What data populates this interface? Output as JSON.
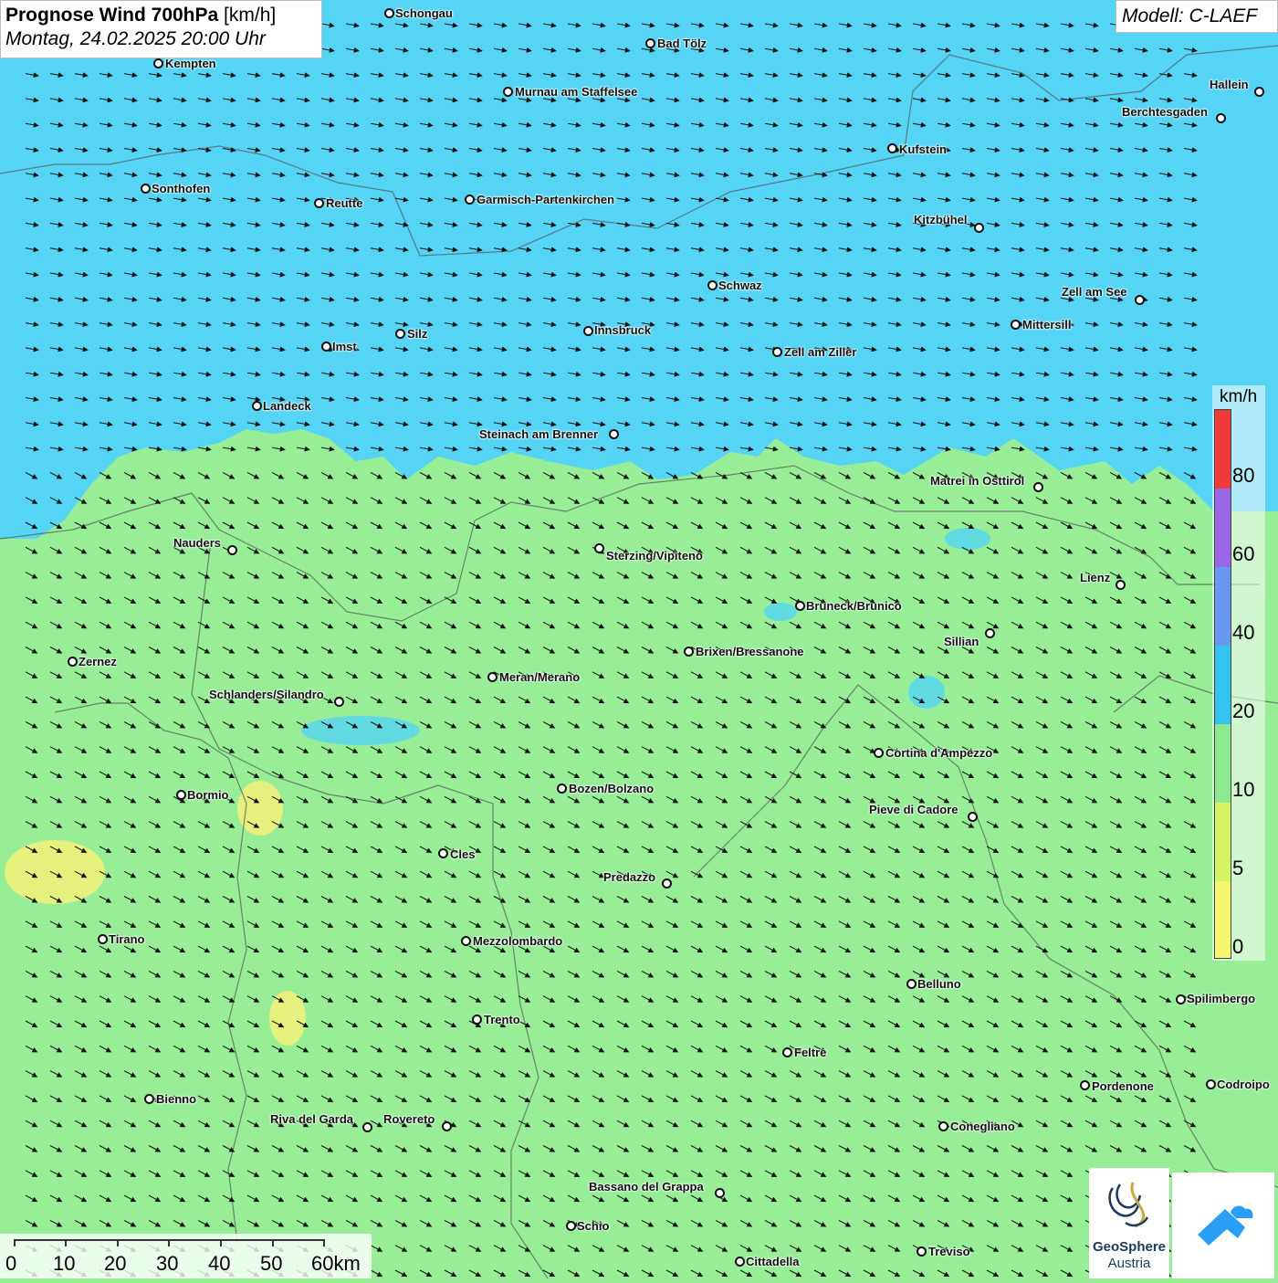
{
  "header": {
    "title_main": "Prognose Wind 700hPa",
    "title_unit": "[km/h]",
    "subtitle": "Montag, 24.02.2025 20:00 Uhr"
  },
  "model": {
    "label": "Modell: C-LAEF"
  },
  "legend": {
    "unit": "km/h",
    "levels": [
      {
        "label": "0",
        "color": "#f5f56e"
      },
      {
        "label": "5",
        "color": "#d6f566"
      },
      {
        "label": "10",
        "color": "#8ee88e"
      },
      {
        "label": "20",
        "color": "#33c3ef"
      },
      {
        "label": "40",
        "color": "#6699ee"
      },
      {
        "label": "60",
        "color": "#9966e6"
      },
      {
        "label": "80",
        "color": "#f03a3a"
      }
    ]
  },
  "map_colors": {
    "low_wind": "#97ee97",
    "mid_wind": "#55d4f5",
    "calm": "#eef07a"
  },
  "wind_direction": "northwest",
  "cities": [
    {
      "name": "Schongau"
    },
    {
      "name": "Bad Tölz"
    },
    {
      "name": "Kempten"
    },
    {
      "name": "Murnau am Staffelsee"
    },
    {
      "name": "Hallein"
    },
    {
      "name": "Berchtesgaden"
    },
    {
      "name": "Kufstein"
    },
    {
      "name": "Sonthofen"
    },
    {
      "name": "Reutte"
    },
    {
      "name": "Garmisch-Partenkirchen"
    },
    {
      "name": "Kitzbühel"
    },
    {
      "name": "Schwaz"
    },
    {
      "name": "Zell am See"
    },
    {
      "name": "Mittersill"
    },
    {
      "name": "Innsbruck"
    },
    {
      "name": "Silz"
    },
    {
      "name": "Imst"
    },
    {
      "name": "Zell am Ziller"
    },
    {
      "name": "Landeck"
    },
    {
      "name": "Steinach am Brenner"
    },
    {
      "name": "Matrei in Osttirol"
    },
    {
      "name": "Nauders"
    },
    {
      "name": "Sterzing/Vipiteno"
    },
    {
      "name": "Lienz"
    },
    {
      "name": "Bruneck/Brunico"
    },
    {
      "name": "Sillian"
    },
    {
      "name": "Zernez"
    },
    {
      "name": "Brixen/Bressanone"
    },
    {
      "name": "Meran/Merano"
    },
    {
      "name": "Schlanders/Silandro"
    },
    {
      "name": "Cortina d'Ampezzo"
    },
    {
      "name": "Bozen/Bolzano"
    },
    {
      "name": "Bormio"
    },
    {
      "name": "Pieve di Cadore"
    },
    {
      "name": "Cles"
    },
    {
      "name": "Predazzo"
    },
    {
      "name": "Tirano"
    },
    {
      "name": "Mezzolombardo"
    },
    {
      "name": "Belluno"
    },
    {
      "name": "Spilimbergo"
    },
    {
      "name": "Trento"
    },
    {
      "name": "Feltre"
    },
    {
      "name": "Pordenone"
    },
    {
      "name": "Codroipo"
    },
    {
      "name": "Bienno"
    },
    {
      "name": "Riva del Garda"
    },
    {
      "name": "Rovereto"
    },
    {
      "name": "Conegliano"
    },
    {
      "name": "Bassano del Grappa"
    },
    {
      "name": "Schio"
    },
    {
      "name": "Treviso"
    },
    {
      "name": "Cittadella"
    }
  ],
  "scale": {
    "ticks": [
      "0",
      "10",
      "20",
      "30",
      "40",
      "50",
      "60km"
    ]
  },
  "logos": {
    "geo_line1": "GeoSphere",
    "geo_line2": "Austria"
  }
}
